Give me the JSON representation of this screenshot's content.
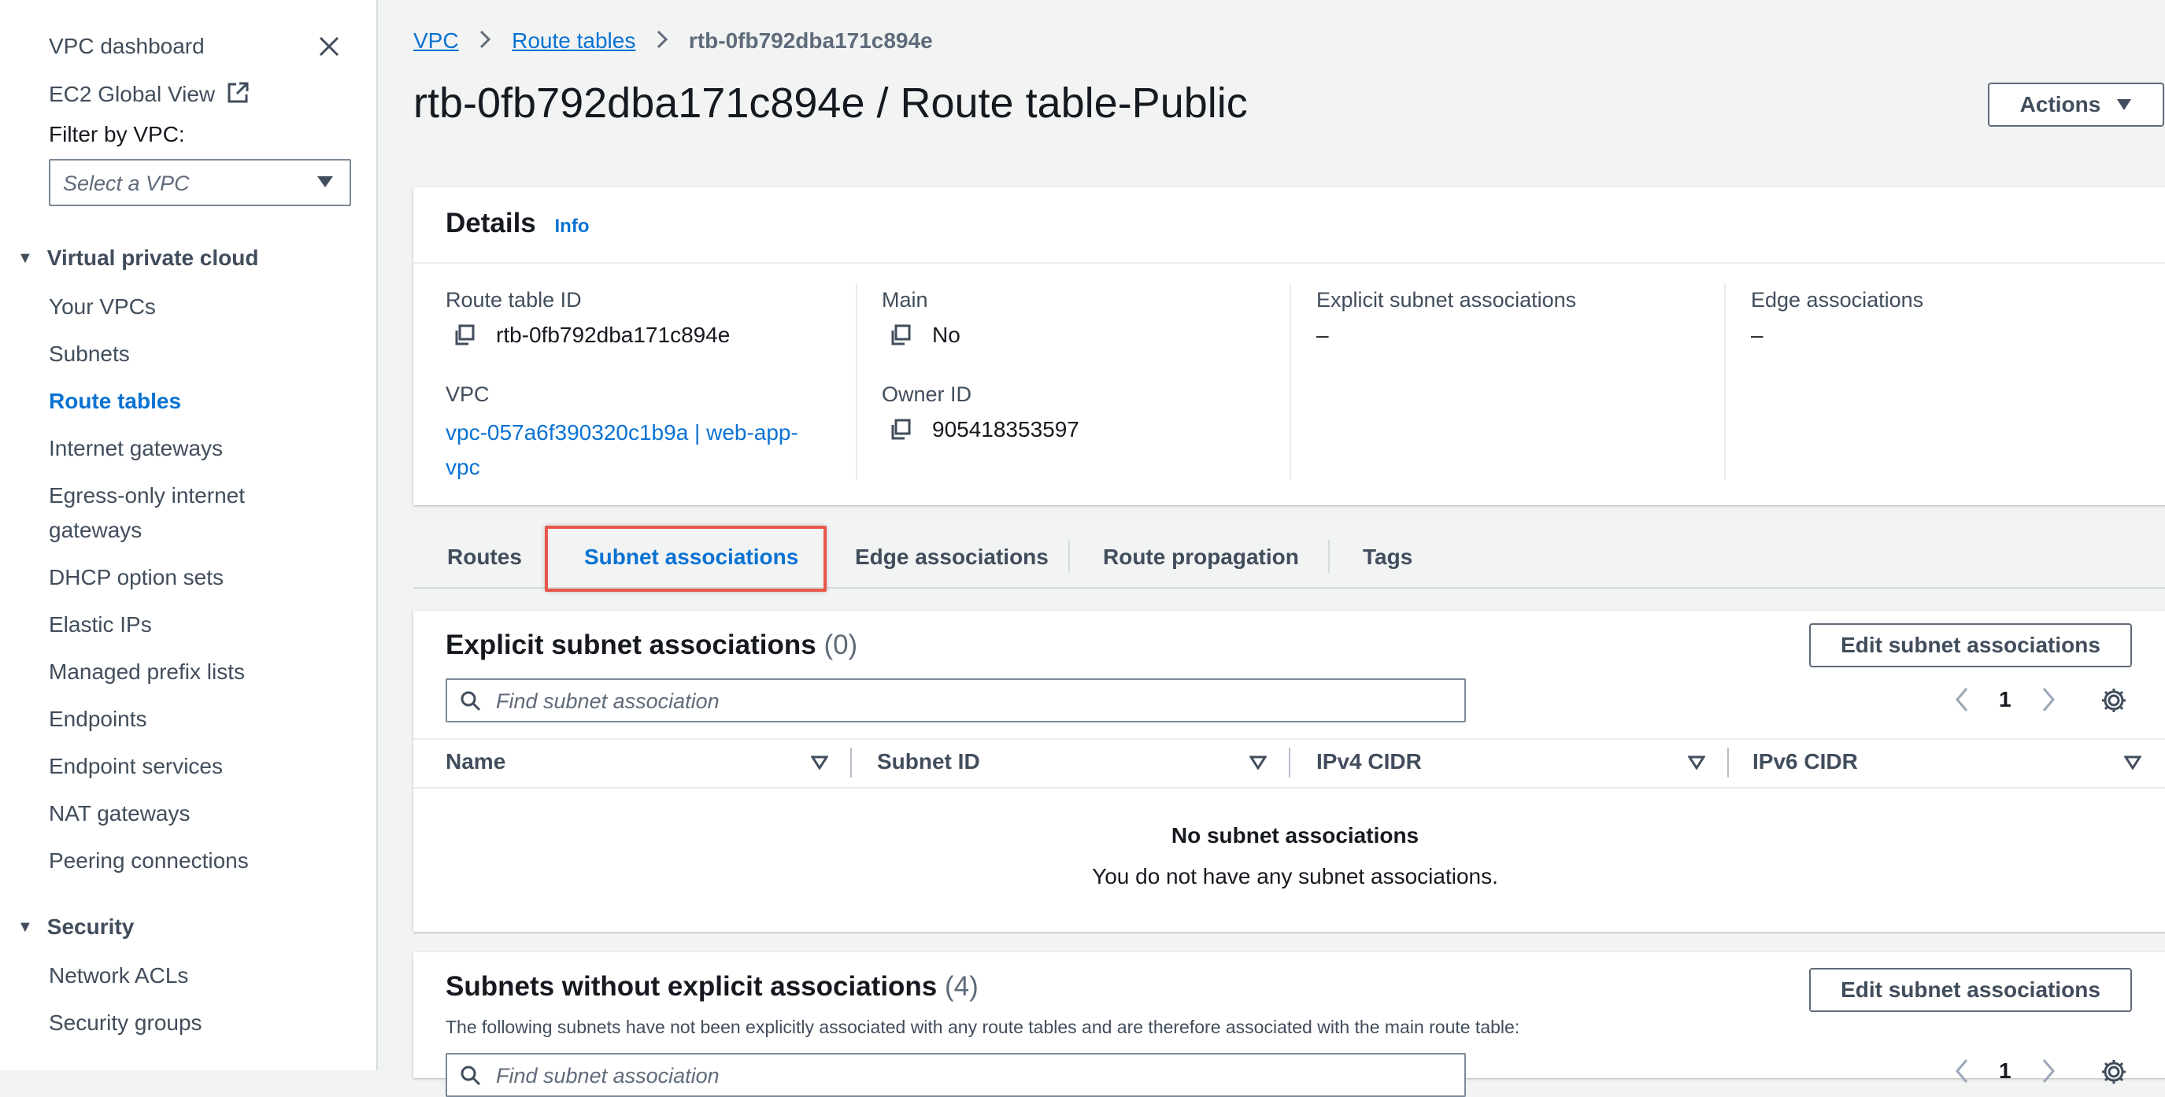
{
  "sidebar": {
    "title": "VPC dashboard",
    "global_view": "EC2 Global View",
    "filter_label": "Filter by VPC:",
    "filter_placeholder": "Select a VPC",
    "sections": [
      {
        "label": "Virtual private cloud",
        "items": [
          "Your VPCs",
          "Subnets",
          "Route tables",
          "Internet gateways",
          "Egress-only internet",
          "gateways",
          "DHCP option sets",
          "Elastic IPs",
          "Managed prefix lists",
          "Endpoints",
          "Endpoint services",
          "NAT gateways",
          "Peering connections"
        ]
      },
      {
        "label": "Security",
        "items": [
          "Network ACLs",
          "Security groups"
        ]
      }
    ]
  },
  "breadcrumb": [
    "VPC",
    "Route tables",
    "rtb-0fb792dba171c894e"
  ],
  "page_title": "rtb-0fb792dba171c894e / Route table-Public",
  "actions_label": "Actions",
  "details": {
    "title": "Details",
    "info": "Info",
    "route_table_id_label": "Route table ID",
    "route_table_id": "rtb-0fb792dba171c894e",
    "vpc_label": "VPC",
    "vpc_value_line1": "vpc-057a6f390320c1b9a | web-app-",
    "vpc_value_line2": "vpc",
    "main_label": "Main",
    "main_value": "No",
    "owner_label": "Owner ID",
    "owner_value": "905418353597",
    "explicit_label": "Explicit subnet associations",
    "explicit_value": "–",
    "edge_label": "Edge associations",
    "edge_value": "–"
  },
  "tabs": [
    "Routes",
    "Subnet associations",
    "Edge associations",
    "Route propagation",
    "Tags"
  ],
  "explicit": {
    "title": "Explicit subnet associations",
    "count": "(0)",
    "edit_button": "Edit subnet associations",
    "search_placeholder": "Find subnet association",
    "page": "1",
    "columns": [
      "Name",
      "Subnet ID",
      "IPv4 CIDR",
      "IPv6 CIDR"
    ],
    "empty_title": "No subnet associations",
    "empty_text": "You do not have any subnet associations."
  },
  "without": {
    "title": "Subnets without explicit associations",
    "count": "(4)",
    "edit_button": "Edit subnet associations",
    "description": "The following subnets have not been explicitly associated with any route tables and are therefore associated with the main route table:",
    "search_placeholder": "Find subnet association",
    "page": "1"
  },
  "colors": {
    "link": "#0972d3",
    "highlight": "#e8574a",
    "background": "#f2f3f3"
  }
}
